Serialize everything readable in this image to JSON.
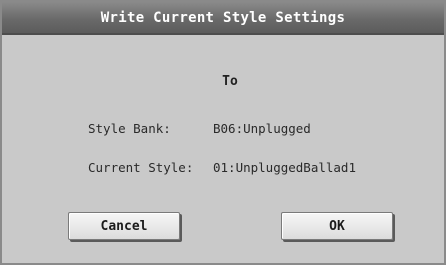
{
  "dialog": {
    "title": "Write Current Style Settings",
    "to_label": "To",
    "rows": [
      {
        "label": "Style Bank:",
        "value": "B06:Unplugged"
      },
      {
        "label": "Current Style:",
        "value": "01:UnpluggedBallad1"
      }
    ],
    "buttons": {
      "cancel": "Cancel",
      "ok": "OK"
    }
  }
}
